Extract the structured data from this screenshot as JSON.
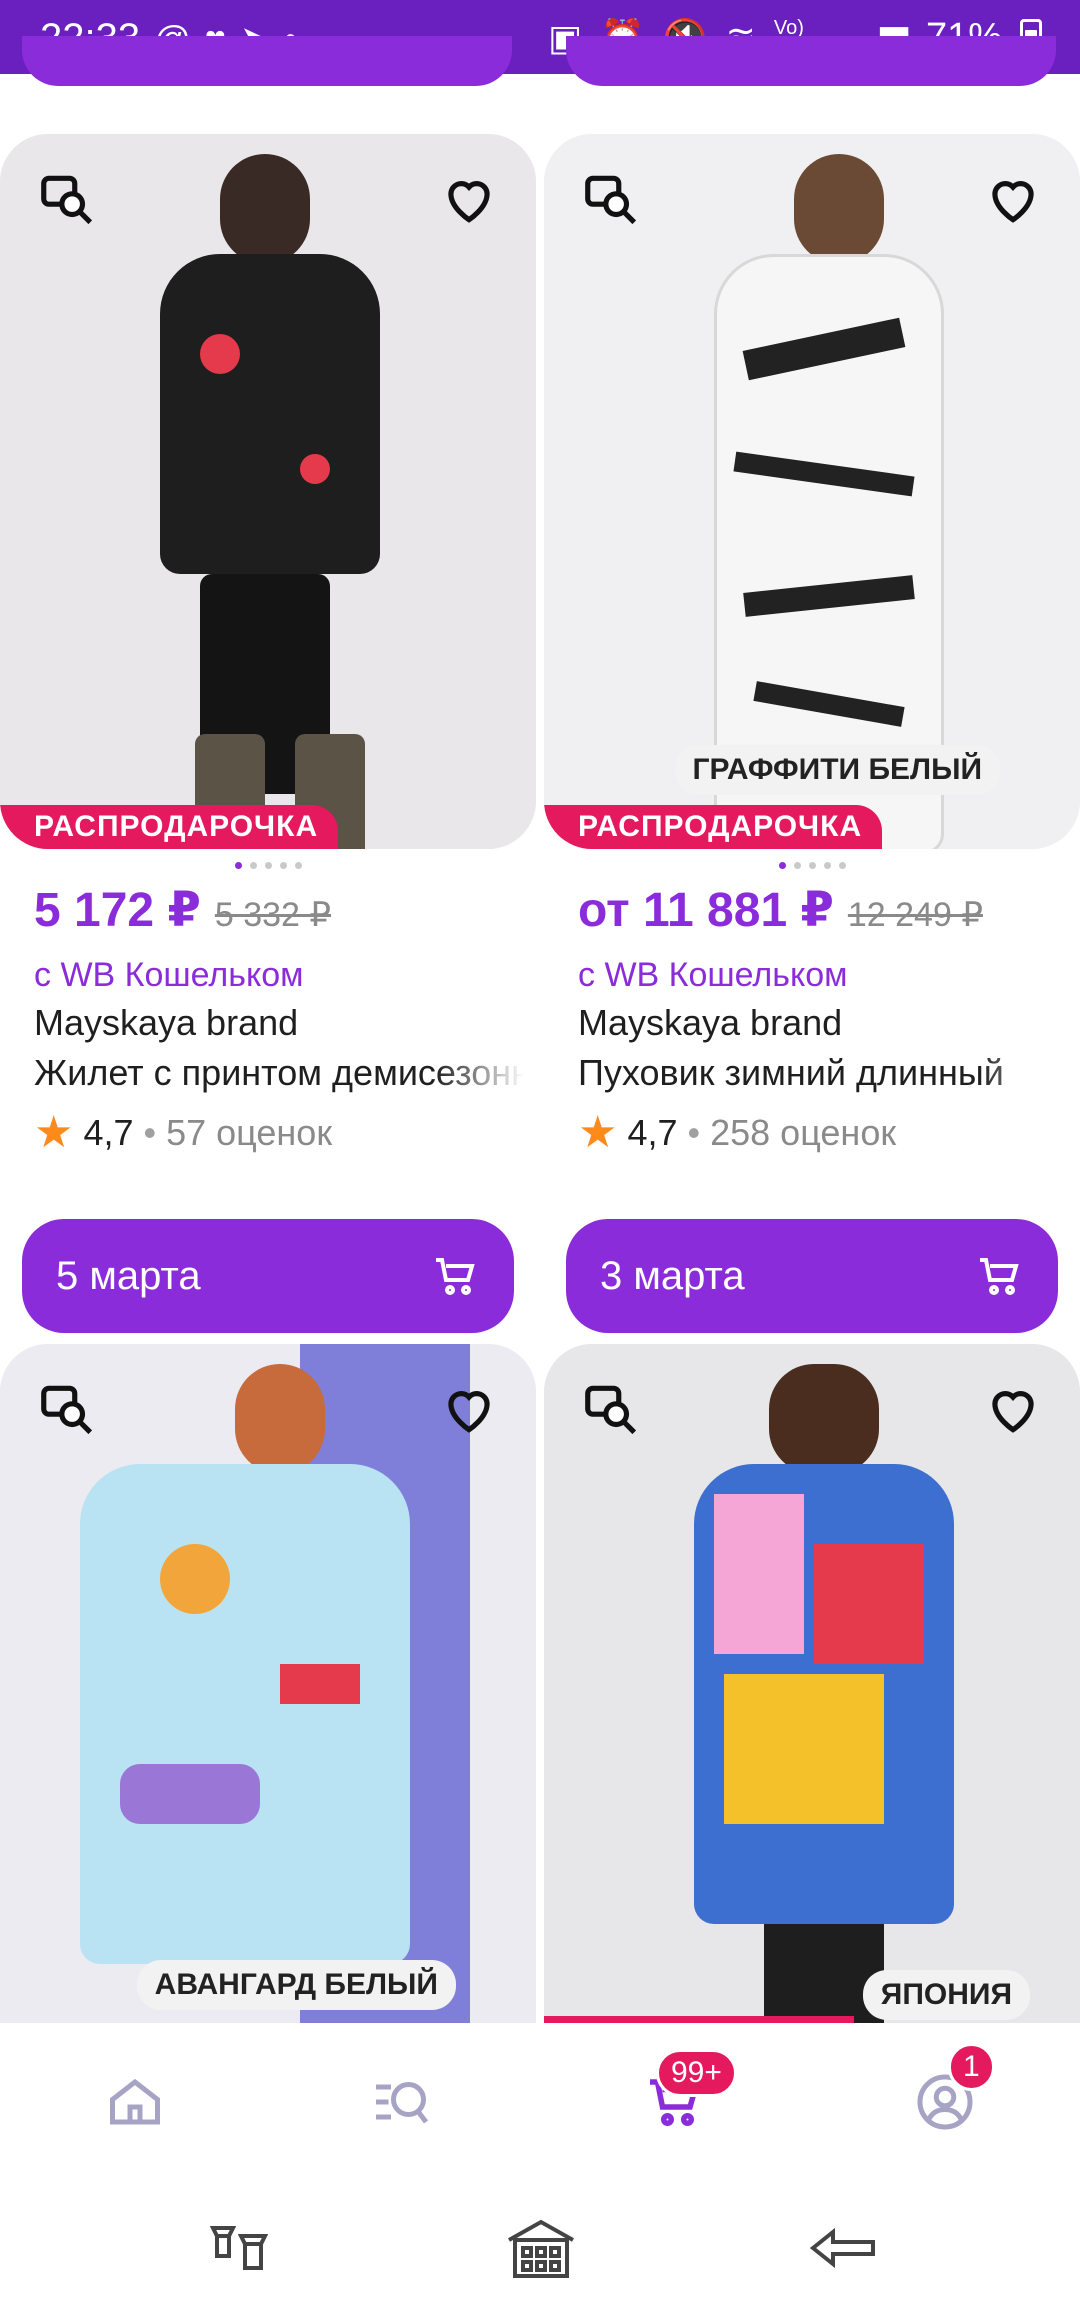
{
  "status_bar": {
    "time": "22:33",
    "left_icons": [
      "at-icon",
      "heart-icon",
      "telegram-icon",
      "dot-icon"
    ],
    "right_icons": [
      "clipboard-icon",
      "alarm-icon",
      "mute-icon",
      "wifi-icon",
      "volte-icon",
      "signal-icon"
    ],
    "battery": "71%"
  },
  "products": [
    {
      "sale_label": "РАСПРОДАРОЧКА",
      "image_label": "",
      "price": "5 172 ₽",
      "old_price": "5 332 ₽",
      "wallet_note": "с WB Кошельком",
      "brand": "Mayskaya brand",
      "title": "Жилет с принтом демисезонный",
      "rating": "4,7",
      "reviews": "57 оценок",
      "delivery": "5 марта",
      "colors": {
        "bg": "#e9e7ea",
        "garment": "#1e1e1e",
        "accent": "#e53a4b"
      }
    },
    {
      "sale_label": "РАСПРОДАРОЧКА",
      "image_label": "ГРАФФИТИ БЕЛЫЙ",
      "price": "от 11 881 ₽",
      "old_price": "12 249 ₽",
      "wallet_note": "с WB Кошельком",
      "brand": "Mayskaya brand",
      "title": "Пуховик зимний длинный",
      "rating": "4,7",
      "reviews": "258 оценок",
      "delivery": "3 марта",
      "colors": {
        "bg": "#f0f0f2",
        "garment": "#f6f6f6",
        "accent": "#222222"
      }
    },
    {
      "image_label": "АВАНГАРД БЕЛЫЙ",
      "colors": {
        "bg": "#ecebf2",
        "panel": "#7f7fd9",
        "garment": "#b9e3f2",
        "accent": "#f2a53b"
      }
    },
    {
      "image_label": "ЯПОНИЯ",
      "colors": {
        "bg": "#e7e7e9",
        "garment": "#3c6fd0",
        "accent": "#f5c12a"
      }
    }
  ],
  "bottom_nav": {
    "items": [
      "home-icon",
      "catalog-search-icon",
      "cart-icon",
      "profile-icon"
    ],
    "cart_badge": "99+",
    "profile_badge": "1"
  },
  "system_nav": [
    "lanterns-icon",
    "home-building-icon",
    "back-arrow-icon"
  ],
  "theme": {
    "primary": "#8b2cdb",
    "sale": "#e5195d",
    "star": "#ff8a1c"
  }
}
